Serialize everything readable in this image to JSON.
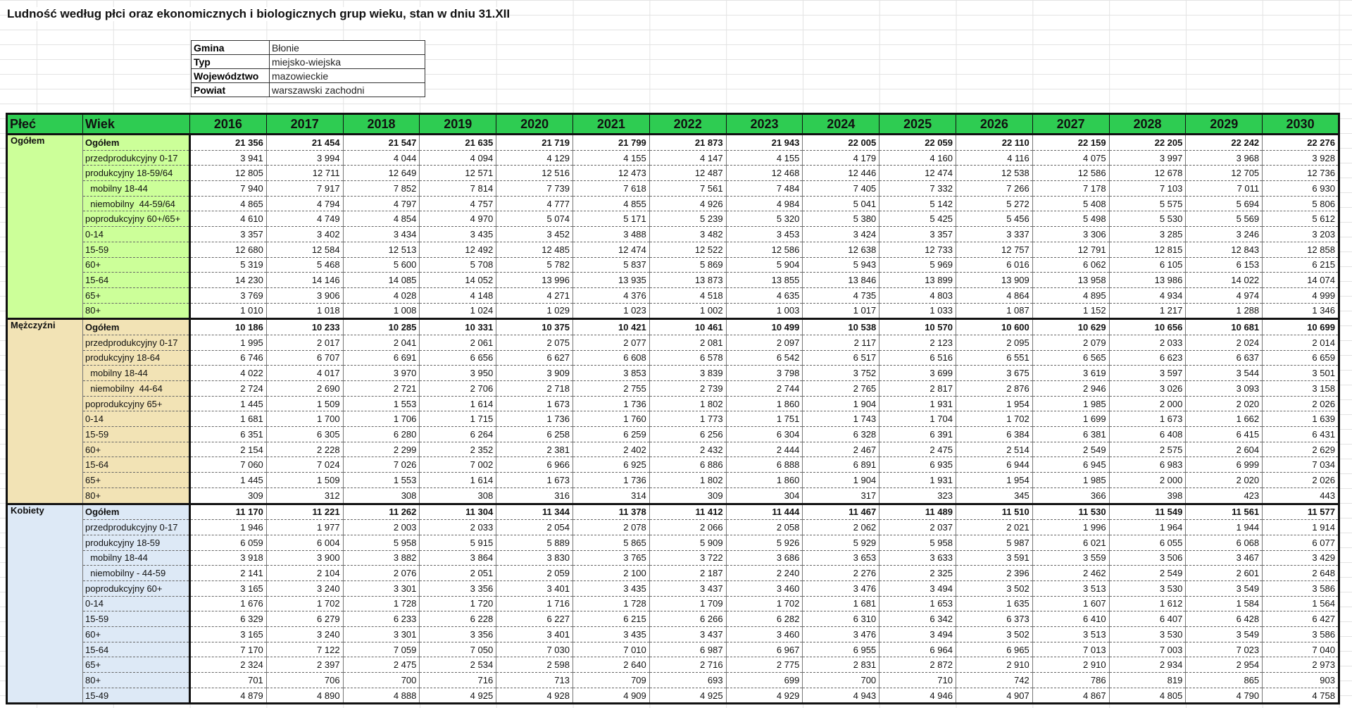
{
  "title": "Ludność według płci oraz ekonomicznych i biologicznych grup wieku, stan w dniu 31.XII",
  "info": [
    {
      "label": "Gmina",
      "value": "Błonie"
    },
    {
      "label": "Typ",
      "value": "miejsko-wiejska"
    },
    {
      "label": "Województwo",
      "value": "mazowieckie"
    },
    {
      "label": "Powiat",
      "value": "warszawski zachodni"
    }
  ],
  "table": {
    "headers": {
      "sex": "Płeć",
      "age": "Wiek"
    },
    "years": [
      "2016",
      "2017",
      "2018",
      "2019",
      "2020",
      "2021",
      "2022",
      "2023",
      "2024",
      "2025",
      "2026",
      "2027",
      "2028",
      "2029",
      "2030"
    ],
    "sections": [
      {
        "label": "Ogółem",
        "color": "#ccff99",
        "rows": [
          {
            "label": "Ogółem",
            "values": [
              "21 356",
              "21 454",
              "21 547",
              "21 635",
              "21 719",
              "21 799",
              "21 873",
              "21 943",
              "22 005",
              "22 059",
              "22 110",
              "22 159",
              "22 205",
              "22 242",
              "22 276"
            ]
          },
          {
            "label": "przedprodukcyjny 0-17",
            "values": [
              "3 941",
              "3 994",
              "4 044",
              "4 094",
              "4 129",
              "4 155",
              "4 147",
              "4 155",
              "4 179",
              "4 160",
              "4 116",
              "4 075",
              "3 997",
              "3 968",
              "3 928"
            ]
          },
          {
            "label": "produkcyjny 18-59/64",
            "values": [
              "12 805",
              "12 711",
              "12 649",
              "12 571",
              "12 516",
              "12 473",
              "12 487",
              "12 468",
              "12 446",
              "12 474",
              "12 538",
              "12 586",
              "12 678",
              "12 705",
              "12 736"
            ]
          },
          {
            "label": "  mobilny 18-44",
            "values": [
              "7 940",
              "7 917",
              "7 852",
              "7 814",
              "7 739",
              "7 618",
              "7 561",
              "7 484",
              "7 405",
              "7 332",
              "7 266",
              "7 178",
              "7 103",
              "7 011",
              "6 930"
            ]
          },
          {
            "label": "  niemobilny  44-59/64",
            "values": [
              "4 865",
              "4 794",
              "4 797",
              "4 757",
              "4 777",
              "4 855",
              "4 926",
              "4 984",
              "5 041",
              "5 142",
              "5 272",
              "5 408",
              "5 575",
              "5 694",
              "5 806"
            ]
          },
          {
            "label": "poprodukcyjny 60+/65+",
            "values": [
              "4 610",
              "4 749",
              "4 854",
              "4 970",
              "5 074",
              "5 171",
              "5 239",
              "5 320",
              "5 380",
              "5 425",
              "5 456",
              "5 498",
              "5 530",
              "5 569",
              "5 612"
            ]
          },
          {
            "label": "0-14",
            "values": [
              "3 357",
              "3 402",
              "3 434",
              "3 435",
              "3 452",
              "3 488",
              "3 482",
              "3 453",
              "3 424",
              "3 357",
              "3 337",
              "3 306",
              "3 285",
              "3 246",
              "3 203"
            ]
          },
          {
            "label": "15-59",
            "values": [
              "12 680",
              "12 584",
              "12 513",
              "12 492",
              "12 485",
              "12 474",
              "12 522",
              "12 586",
              "12 638",
              "12 733",
              "12 757",
              "12 791",
              "12 815",
              "12 843",
              "12 858"
            ]
          },
          {
            "label": "60+",
            "values": [
              "5 319",
              "5 468",
              "5 600",
              "5 708",
              "5 782",
              "5 837",
              "5 869",
              "5 904",
              "5 943",
              "5 969",
              "6 016",
              "6 062",
              "6 105",
              "6 153",
              "6 215"
            ]
          },
          {
            "label": "15-64",
            "values": [
              "14 230",
              "14 146",
              "14 085",
              "14 052",
              "13 996",
              "13 935",
              "13 873",
              "13 855",
              "13 846",
              "13 899",
              "13 909",
              "13 958",
              "13 986",
              "14 022",
              "14 074"
            ]
          },
          {
            "label": "65+",
            "values": [
              "3 769",
              "3 906",
              "4 028",
              "4 148",
              "4 271",
              "4 376",
              "4 518",
              "4 635",
              "4 735",
              "4 803",
              "4 864",
              "4 895",
              "4 934",
              "4 974",
              "4 999"
            ]
          },
          {
            "label": "80+",
            "values": [
              "1 010",
              "1 018",
              "1 008",
              "1 024",
              "1 029",
              "1 023",
              "1 002",
              "1 003",
              "1 017",
              "1 033",
              "1 087",
              "1 152",
              "1 217",
              "1 288",
              "1 346"
            ]
          }
        ]
      },
      {
        "label": "Mężczyźni",
        "color": "#f2e3b5",
        "rows": [
          {
            "label": "Ogółem",
            "values": [
              "10 186",
              "10 233",
              "10 285",
              "10 331",
              "10 375",
              "10 421",
              "10 461",
              "10 499",
              "10 538",
              "10 570",
              "10 600",
              "10 629",
              "10 656",
              "10 681",
              "10 699"
            ]
          },
          {
            "label": "przedprodukcyjny 0-17",
            "values": [
              "1 995",
              "2 017",
              "2 041",
              "2 061",
              "2 075",
              "2 077",
              "2 081",
              "2 097",
              "2 117",
              "2 123",
              "2 095",
              "2 079",
              "2 033",
              "2 024",
              "2 014"
            ]
          },
          {
            "label": "produkcyjny 18-64",
            "values": [
              "6 746",
              "6 707",
              "6 691",
              "6 656",
              "6 627",
              "6 608",
              "6 578",
              "6 542",
              "6 517",
              "6 516",
              "6 551",
              "6 565",
              "6 623",
              "6 637",
              "6 659"
            ]
          },
          {
            "label": "  mobilny 18-44",
            "values": [
              "4 022",
              "4 017",
              "3 970",
              "3 950",
              "3 909",
              "3 853",
              "3 839",
              "3 798",
              "3 752",
              "3 699",
              "3 675",
              "3 619",
              "3 597",
              "3 544",
              "3 501"
            ]
          },
          {
            "label": "  niemobilny  44-64",
            "values": [
              "2 724",
              "2 690",
              "2 721",
              "2 706",
              "2 718",
              "2 755",
              "2 739",
              "2 744",
              "2 765",
              "2 817",
              "2 876",
              "2 946",
              "3 026",
              "3 093",
              "3 158"
            ]
          },
          {
            "label": "poprodukcyjny 65+",
            "values": [
              "1 445",
              "1 509",
              "1 553",
              "1 614",
              "1 673",
              "1 736",
              "1 802",
              "1 860",
              "1 904",
              "1 931",
              "1 954",
              "1 985",
              "2 000",
              "2 020",
              "2 026"
            ]
          },
          {
            "label": "0-14",
            "values": [
              "1 681",
              "1 700",
              "1 706",
              "1 715",
              "1 736",
              "1 760",
              "1 773",
              "1 751",
              "1 743",
              "1 704",
              "1 702",
              "1 699",
              "1 673",
              "1 662",
              "1 639"
            ]
          },
          {
            "label": "15-59",
            "values": [
              "6 351",
              "6 305",
              "6 280",
              "6 264",
              "6 258",
              "6 259",
              "6 256",
              "6 304",
              "6 328",
              "6 391",
              "6 384",
              "6 381",
              "6 408",
              "6 415",
              "6 431"
            ]
          },
          {
            "label": "60+",
            "values": [
              "2 154",
              "2 228",
              "2 299",
              "2 352",
              "2 381",
              "2 402",
              "2 432",
              "2 444",
              "2 467",
              "2 475",
              "2 514",
              "2 549",
              "2 575",
              "2 604",
              "2 629"
            ]
          },
          {
            "label": "15-64",
            "values": [
              "7 060",
              "7 024",
              "7 026",
              "7 002",
              "6 966",
              "6 925",
              "6 886",
              "6 888",
              "6 891",
              "6 935",
              "6 944",
              "6 945",
              "6 983",
              "6 999",
              "7 034"
            ]
          },
          {
            "label": "65+",
            "values": [
              "1 445",
              "1 509",
              "1 553",
              "1 614",
              "1 673",
              "1 736",
              "1 802",
              "1 860",
              "1 904",
              "1 931",
              "1 954",
              "1 985",
              "2 000",
              "2 020",
              "2 026"
            ]
          },
          {
            "label": "80+",
            "values": [
              "309",
              "312",
              "308",
              "308",
              "316",
              "314",
              "309",
              "304",
              "317",
              "323",
              "345",
              "366",
              "398",
              "423",
              "443"
            ]
          }
        ]
      },
      {
        "label": "Kobiety",
        "color": "#dde9f6",
        "rows": [
          {
            "label": "Ogółem",
            "values": [
              "11 170",
              "11 221",
              "11 262",
              "11 304",
              "11 344",
              "11 378",
              "11 412",
              "11 444",
              "11 467",
              "11 489",
              "11 510",
              "11 530",
              "11 549",
              "11 561",
              "11 577"
            ]
          },
          {
            "label": "przedprodukcyjny 0-17",
            "values": [
              "1 946",
              "1 977",
              "2 003",
              "2 033",
              "2 054",
              "2 078",
              "2 066",
              "2 058",
              "2 062",
              "2 037",
              "2 021",
              "1 996",
              "1 964",
              "1 944",
              "1 914"
            ]
          },
          {
            "label": "produkcyjny 18-59",
            "values": [
              "6 059",
              "6 004",
              "5 958",
              "5 915",
              "5 889",
              "5 865",
              "5 909",
              "5 926",
              "5 929",
              "5 958",
              "5 987",
              "6 021",
              "6 055",
              "6 068",
              "6 077"
            ]
          },
          {
            "label": "  mobilny 18-44",
            "values": [
              "3 918",
              "3 900",
              "3 882",
              "3 864",
              "3 830",
              "3 765",
              "3 722",
              "3 686",
              "3 653",
              "3 633",
              "3 591",
              "3 559",
              "3 506",
              "3 467",
              "3 429"
            ]
          },
          {
            "label": "  niemobilny - 44-59",
            "values": [
              "2 141",
              "2 104",
              "2 076",
              "2 051",
              "2 059",
              "2 100",
              "2 187",
              "2 240",
              "2 276",
              "2 325",
              "2 396",
              "2 462",
              "2 549",
              "2 601",
              "2 648"
            ]
          },
          {
            "label": "poprodukcyjny 60+",
            "values": [
              "3 165",
              "3 240",
              "3 301",
              "3 356",
              "3 401",
              "3 435",
              "3 437",
              "3 460",
              "3 476",
              "3 494",
              "3 502",
              "3 513",
              "3 530",
              "3 549",
              "3 586"
            ]
          },
          {
            "label": "0-14",
            "values": [
              "1 676",
              "1 702",
              "1 728",
              "1 720",
              "1 716",
              "1 728",
              "1 709",
              "1 702",
              "1 681",
              "1 653",
              "1 635",
              "1 607",
              "1 612",
              "1 584",
              "1 564"
            ]
          },
          {
            "label": "15-59",
            "values": [
              "6 329",
              "6 279",
              "6 233",
              "6 228",
              "6 227",
              "6 215",
              "6 266",
              "6 282",
              "6 310",
              "6 342",
              "6 373",
              "6 410",
              "6 407",
              "6 428",
              "6 427"
            ]
          },
          {
            "label": "60+",
            "values": [
              "3 165",
              "3 240",
              "3 301",
              "3 356",
              "3 401",
              "3 435",
              "3 437",
              "3 460",
              "3 476",
              "3 494",
              "3 502",
              "3 513",
              "3 530",
              "3 549",
              "3 586"
            ]
          },
          {
            "label": "15-64",
            "values": [
              "7 170",
              "7 122",
              "7 059",
              "7 050",
              "7 030",
              "7 010",
              "6 987",
              "6 967",
              "6 955",
              "6 964",
              "6 965",
              "7 013",
              "7 003",
              "7 023",
              "7 040"
            ]
          },
          {
            "label": "65+",
            "values": [
              "2 324",
              "2 397",
              "2 475",
              "2 534",
              "2 598",
              "2 640",
              "2 716",
              "2 775",
              "2 831",
              "2 872",
              "2 910",
              "2 910",
              "2 934",
              "2 954",
              "2 973"
            ]
          },
          {
            "label": "80+",
            "values": [
              "701",
              "706",
              "700",
              "716",
              "713",
              "709",
              "693",
              "699",
              "700",
              "710",
              "742",
              "786",
              "819",
              "865",
              "903"
            ]
          },
          {
            "label": "15-49",
            "values": [
              "4 879",
              "4 890",
              "4 888",
              "4 925",
              "4 928",
              "4 909",
              "4 925",
              "4 929",
              "4 943",
              "4 946",
              "4 907",
              "4 867",
              "4 805",
              "4 790",
              "4 758"
            ]
          }
        ]
      }
    ]
  }
}
